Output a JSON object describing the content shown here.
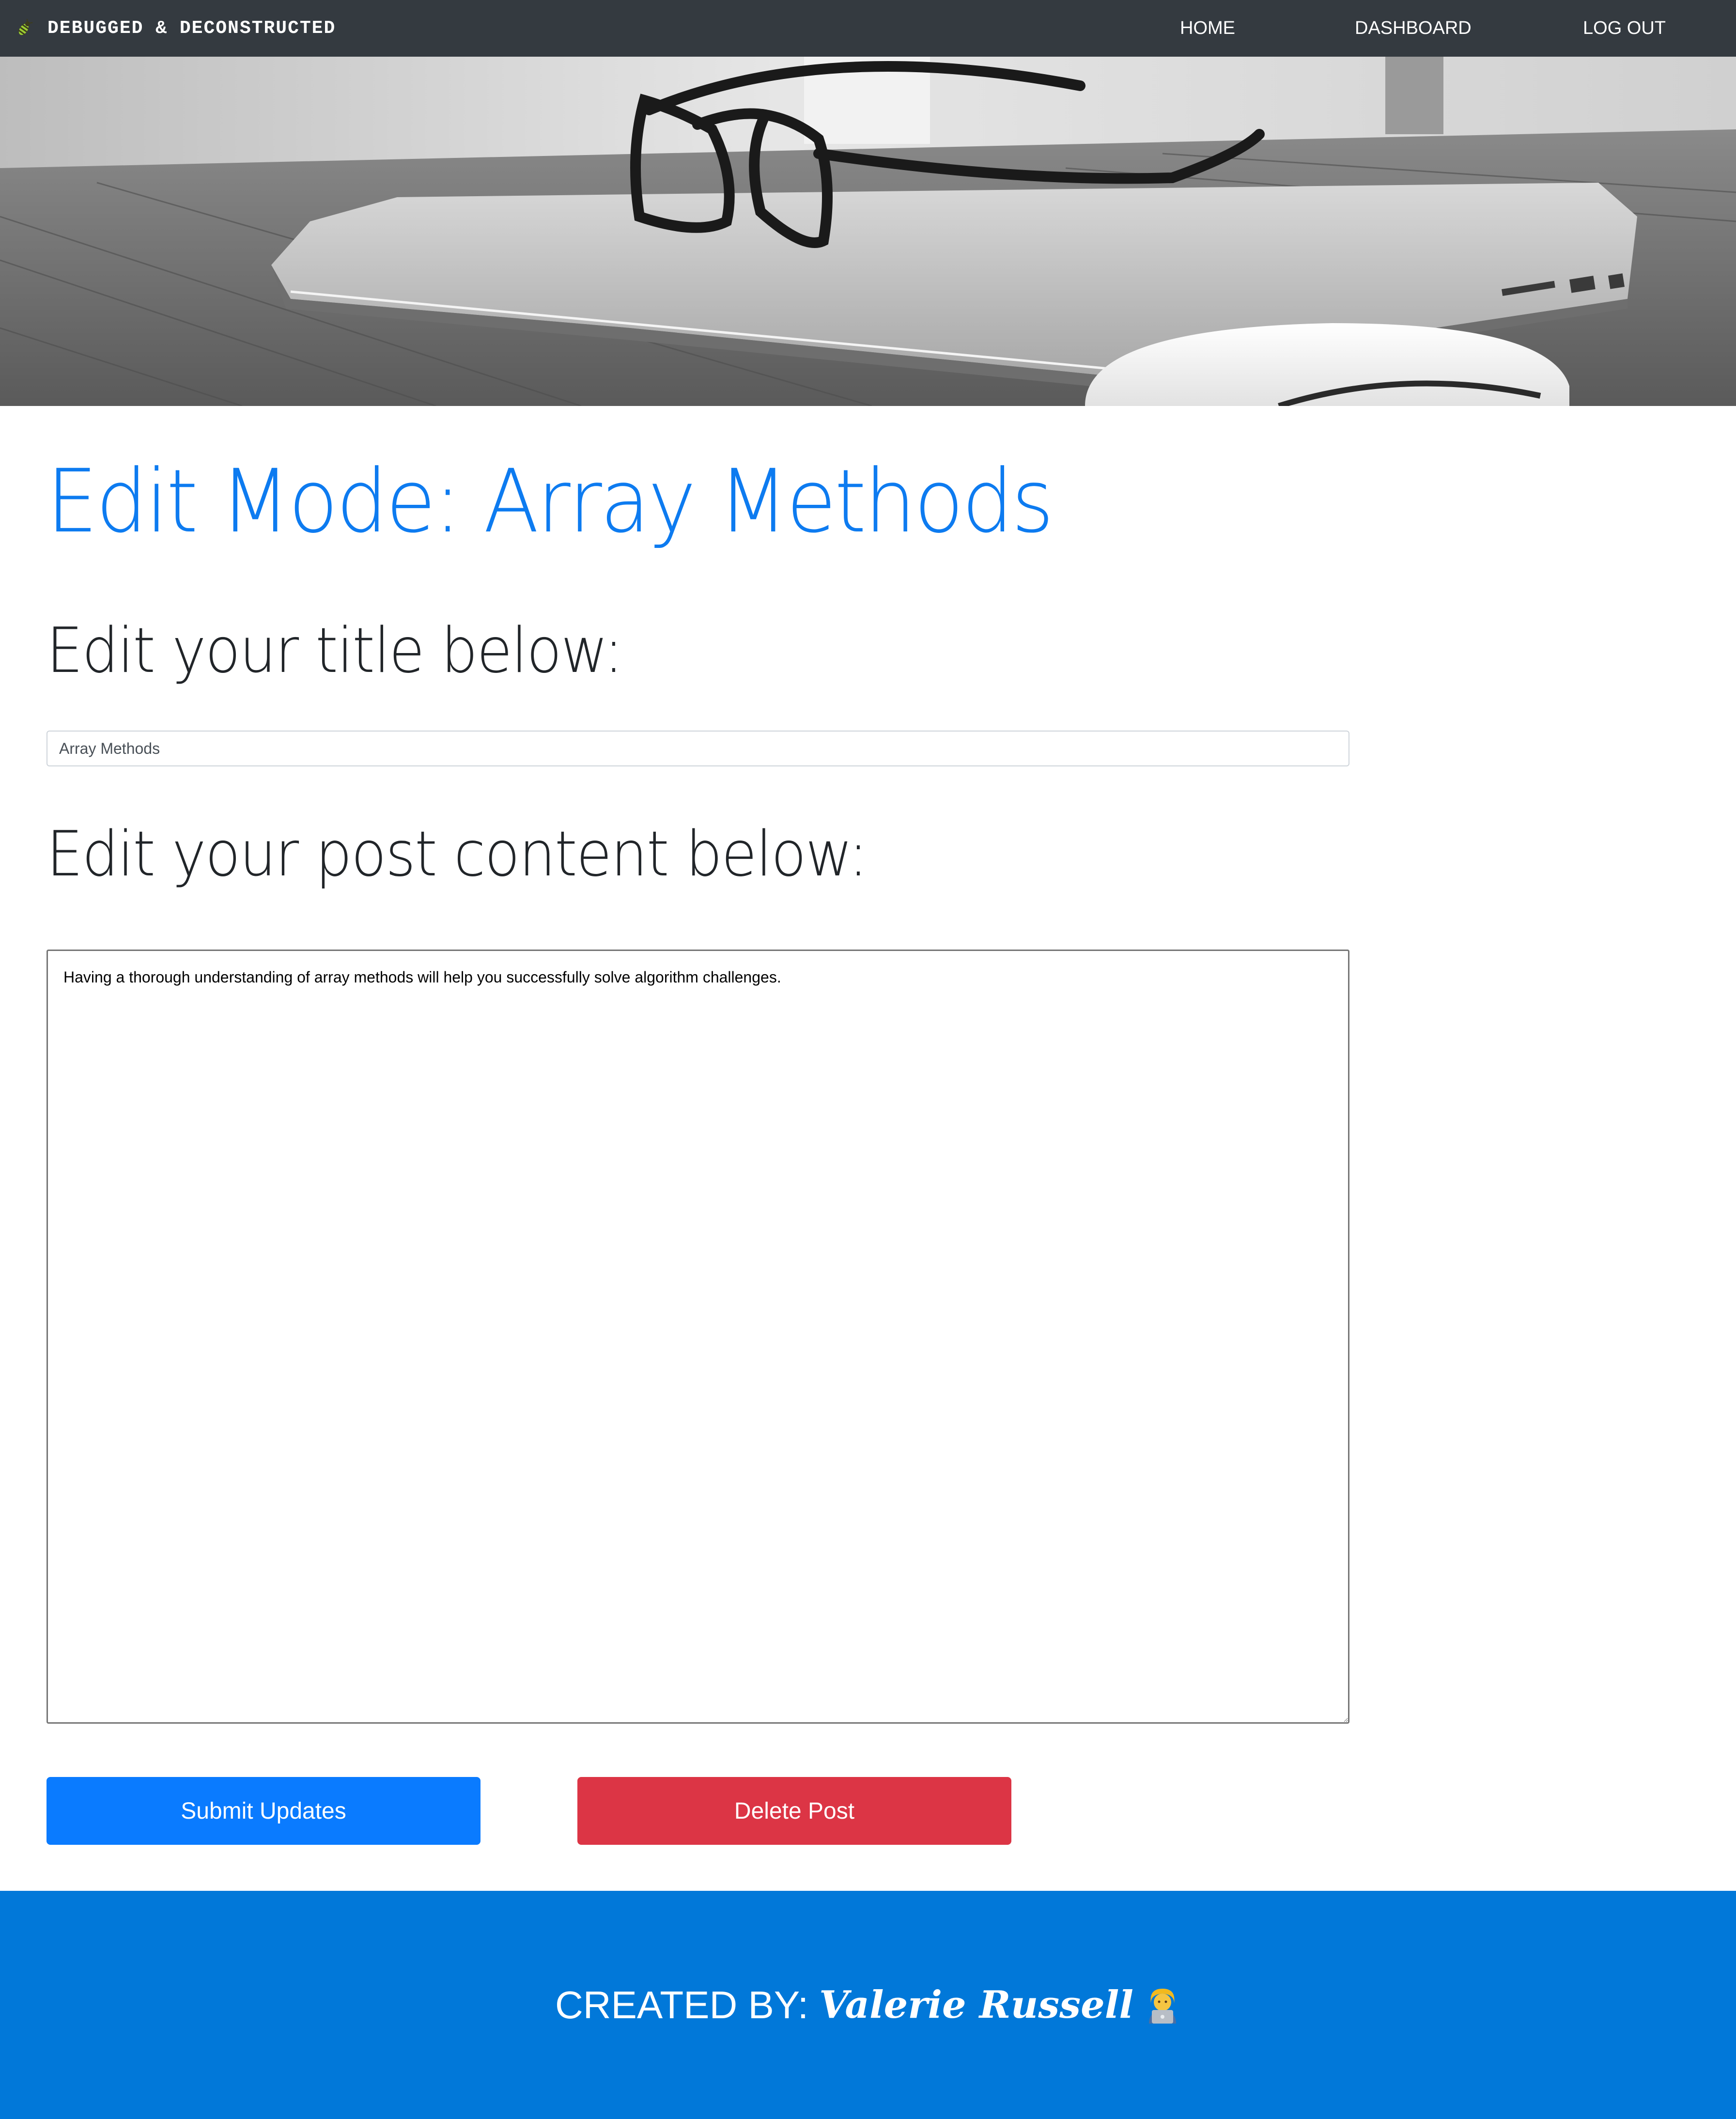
{
  "navbar": {
    "brand_text": "DEBUGGED & DECONSTRUCTED",
    "brand_icon": "bug-icon",
    "links": [
      {
        "label": "HOME"
      },
      {
        "label": "DASHBOARD"
      },
      {
        "label": "LOG OUT"
      }
    ]
  },
  "hero": {
    "image": "laptop-glasses-mouse-photo"
  },
  "main": {
    "page_title": "Edit Mode: Array Methods",
    "title_heading": "Edit your title below:",
    "title_value": "Array Methods",
    "content_heading": "Edit your post content below:",
    "content_value": "Having a thorough understanding of array methods will help you successfully solve algorithm challenges.",
    "submit_label": "Submit Updates",
    "delete_label": "Delete Post"
  },
  "footer": {
    "created_by": "CREATED BY:",
    "author": "Valerie Russell",
    "icon": "person-at-laptop-icon"
  },
  "colors": {
    "navbar_bg": "#343a40",
    "title_blue": "#0d7bf0",
    "submit_blue": "#0a7bff",
    "delete_red": "#dc3545",
    "footer_blue": "#0178d9"
  }
}
